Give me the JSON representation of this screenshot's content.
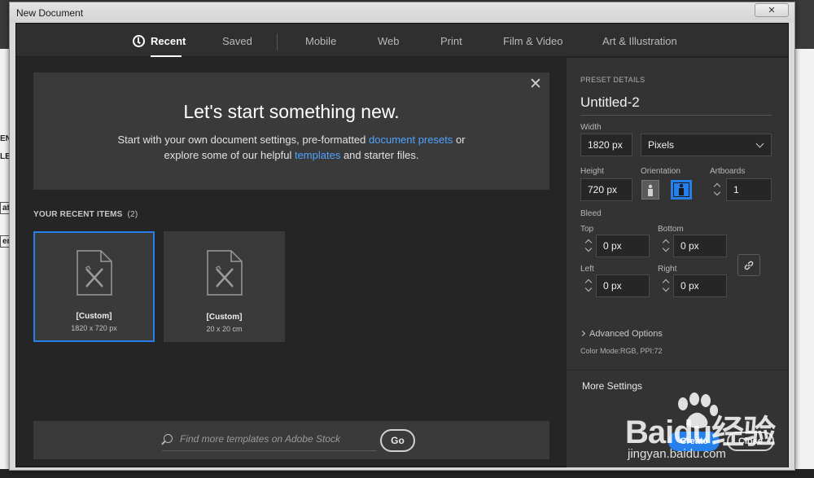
{
  "window": {
    "title": "New Document",
    "close_glyph": "✕"
  },
  "tabs": [
    {
      "label": "Recent",
      "active": true
    },
    {
      "label": "Saved"
    },
    {
      "label": "Mobile"
    },
    {
      "label": "Web"
    },
    {
      "label": "Print"
    },
    {
      "label": "Film & Video"
    },
    {
      "label": "Art & Illustration"
    }
  ],
  "hero": {
    "title": "Let's start something new.",
    "line1_pre": "Start with your own document settings, pre-formatted ",
    "line1_link": "document presets",
    "line1_post": " or",
    "line2_pre": "explore some of our helpful ",
    "line2_link": "templates",
    "line2_post": " and starter files.",
    "close_glyph": "✕"
  },
  "recent": {
    "heading": "YOUR RECENT ITEMS",
    "count": "(2)",
    "items": [
      {
        "label": "[Custom]",
        "dimensions": "1820 x 720 px",
        "selected": true
      },
      {
        "label": "[Custom]",
        "dimensions": "20 x 20 cm",
        "selected": false
      }
    ]
  },
  "stock": {
    "placeholder": "Find more templates on Adobe Stock",
    "go_label": "Go"
  },
  "preset": {
    "section_label": "PRESET DETAILS",
    "name": "Untitled-2",
    "width_label": "Width",
    "width_value": "1820 px",
    "units_value": "Pixels",
    "height_label": "Height",
    "height_value": "720 px",
    "orientation_label": "Orientation",
    "artboards_label": "Artboards",
    "artboards_value": "1",
    "bleed_label": "Bleed",
    "top_label": "Top",
    "top_value": "0 px",
    "bottom_label": "Bottom",
    "bottom_value": "0 px",
    "left_label": "Left",
    "left_value": "0 px",
    "right_label": "Right",
    "right_value": "0 px",
    "advanced_label": "Advanced Options",
    "color_mode": "Color Mode:RGB, PPI:72",
    "more_settings": "More Settings",
    "create_label": "Create",
    "close_label": "Close"
  },
  "background": {
    "frag1": "ENT",
    "frag2": "LE",
    "frag3": "ate",
    "frag4": "en."
  },
  "watermark": {
    "brand": "Baidu经验",
    "url": "jingyan.baidu.com"
  },
  "colors": {
    "accent": "#2680eb",
    "link": "#4fa3ff",
    "panel": "#333333",
    "dialog": "#252525"
  }
}
